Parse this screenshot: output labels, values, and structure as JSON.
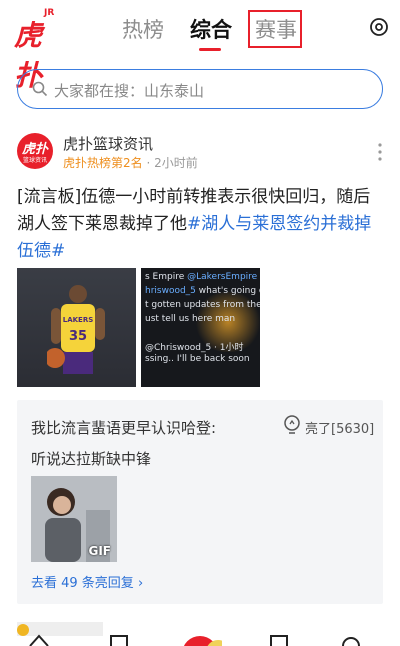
{
  "header": {
    "logo_text": "虎扑",
    "logo_badge": "JR",
    "tabs": [
      "热榜",
      "综合",
      "赛事"
    ],
    "active_tab": "综合",
    "icon": "basketball-icon"
  },
  "search": {
    "placeholder": "大家都在搜：山东泰山",
    "icon": "search-icon"
  },
  "post": {
    "avatar_text": "虎扑",
    "avatar_subtext": "篮球资讯",
    "author": "虎扑篮球资讯",
    "rank": "虎扑热榜第2名",
    "time": "2小时前",
    "body_text": "[流言板]伍德一小时前转推表示很快回归，随后湖人签下莱恩裁掉了他",
    "hashtag": "#湖人与莱恩签约并裁掉伍德#",
    "images": [
      {
        "name": "player-photo",
        "jersey_team": "LAKERS",
        "jersey_number": "35"
      },
      {
        "name": "tweet-screenshot",
        "lines": [
          {
            "handle": "s Empire",
            "text": "@LakersEmpire"
          },
          {
            "handle": "hriswood_5",
            "text": "what's going on w"
          },
          {
            "handle": "",
            "text": "t gotten updates from the tea"
          },
          {
            "handle": "",
            "text": "ust tell us here man"
          },
          {
            "handle": "",
            "text": "@Chriswood_5 · 1小时"
          },
          {
            "handle": "",
            "text": "ssing.. I'll be back soon"
          }
        ]
      }
    ]
  },
  "reply": {
    "text": "我比流言蜚语更早认识哈登:",
    "light_label": "亮了[5630]",
    "text2": "听说达拉斯缺中锋",
    "gif_label": "GIF",
    "more_link": "去看 49 条亮回复 ›"
  },
  "colors": {
    "brand_red": "#e8202b",
    "link_blue": "#2a6fd6",
    "rank_orange": "#ee8e1c",
    "search_border": "#3b7de0"
  }
}
